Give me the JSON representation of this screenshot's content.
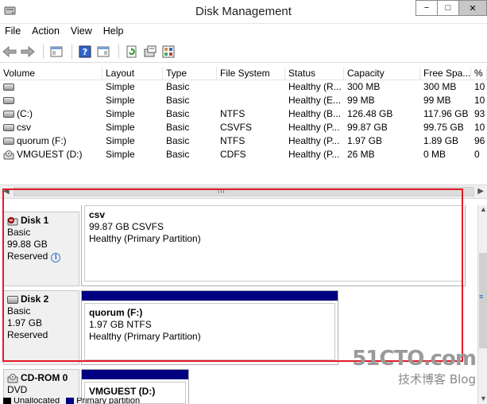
{
  "window": {
    "title": "Disk Management",
    "min": "−",
    "max": "□",
    "close": "✕"
  },
  "menu": [
    "File",
    "Action",
    "View",
    "Help"
  ],
  "columns": [
    "Volume",
    "Layout",
    "Type",
    "File System",
    "Status",
    "Capacity",
    "Free Spa...",
    "%"
  ],
  "volumes": [
    {
      "volume": "",
      "layout": "Simple",
      "type": "Basic",
      "fs": "",
      "status": "Healthy (R...",
      "capacity": "300 MB",
      "free": "300 MB",
      "pct": "10"
    },
    {
      "volume": "",
      "layout": "Simple",
      "type": "Basic",
      "fs": "",
      "status": "Healthy (E...",
      "capacity": "99 MB",
      "free": "99 MB",
      "pct": "10"
    },
    {
      "volume": "(C:)",
      "layout": "Simple",
      "type": "Basic",
      "fs": "NTFS",
      "status": "Healthy (B...",
      "capacity": "126.48 GB",
      "free": "117.96 GB",
      "pct": "93"
    },
    {
      "volume": "csv",
      "layout": "Simple",
      "type": "Basic",
      "fs": "CSVFS",
      "status": "Healthy (P...",
      "capacity": "99.87 GB",
      "free": "99.75 GB",
      "pct": "10"
    },
    {
      "volume": "quorum (F:)",
      "layout": "Simple",
      "type": "Basic",
      "fs": "NTFS",
      "status": "Healthy (P...",
      "capacity": "1.97 GB",
      "free": "1.89 GB",
      "pct": "96"
    },
    {
      "volume": "VMGUEST (D:)",
      "layout": "Simple",
      "type": "Basic",
      "fs": "CDFS",
      "status": "Healthy (P...",
      "capacity": "26 MB",
      "free": "0 MB",
      "pct": "0"
    }
  ],
  "hscroll_grip": "III",
  "disks": [
    {
      "name": "Disk 1",
      "kind": "Basic",
      "size": "99.88 GB",
      "state": "Reserved",
      "info_icon": "i",
      "partition": {
        "name": "csv",
        "size_fs": "99.87 GB CSVFS",
        "status": "Healthy (Primary Partition)"
      }
    },
    {
      "name": "Disk 2",
      "kind": "Basic",
      "size": "1.97 GB",
      "state": "Reserved",
      "partition": {
        "name": "quorum  (F:)",
        "size_fs": "1.97 GB NTFS",
        "status": "Healthy (Primary Partition)"
      }
    },
    {
      "name": "CD-ROM 0",
      "kind": "DVD",
      "partition": {
        "name": "VMGUEST  (D:)"
      }
    }
  ],
  "legend": [
    "Unallocated",
    "Primary partition"
  ],
  "watermark": {
    "site": "51CTO.com",
    "sub": "技术博客",
    "blog": "Blog"
  },
  "colors": {
    "partition_bar": "#000080",
    "highlight": "#e01b24",
    "unallocated": "#000000"
  }
}
